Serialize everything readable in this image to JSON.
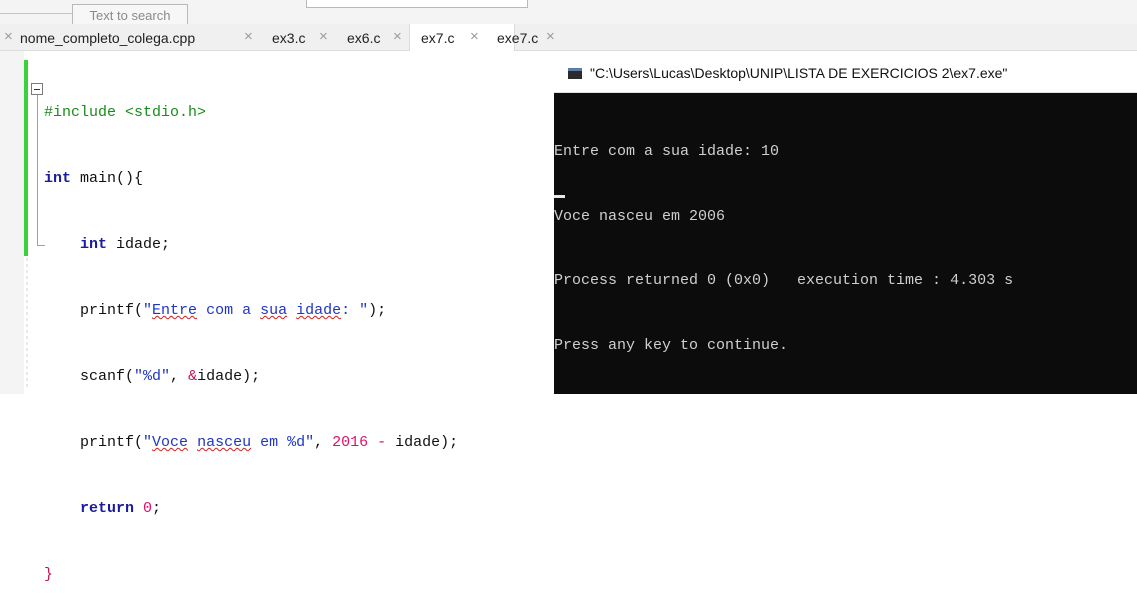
{
  "search": {
    "placeholder": "Text to search"
  },
  "tabs": [
    {
      "label": "nome_completo_colega.cpp",
      "active": false
    },
    {
      "label": "ex3.c",
      "active": false
    },
    {
      "label": "ex6.c",
      "active": false
    },
    {
      "label": "ex7.c",
      "active": true
    },
    {
      "label": "exe7.c",
      "active": false
    }
  ],
  "tab_close_glyph": "×",
  "code": {
    "l1": "#include <stdio.h>",
    "l2_kw": "int",
    "l2_rest": " main(){",
    "l3_kw": "int",
    "l3_rest": " idade;",
    "l4_fn": "printf(",
    "l4_str_a": "\"",
    "l4_w1": "Entre",
    "l4_str_b": " com a ",
    "l4_w2": "sua",
    "l4_str_c": " ",
    "l4_w3": "idade",
    "l4_str_d": ": \"",
    "l4_end": ");",
    "l5_fn": "scanf(",
    "l5_str": "\"%d\"",
    "l5_mid": ", ",
    "l5_amp": "&",
    "l5_end": "idade);",
    "l6_fn": "printf(",
    "l6_str_a": "\"",
    "l6_w1": "Voce",
    "l6_str_b": " ",
    "l6_w2": "nasceu",
    "l6_str_c": " em %d\"",
    "l6_mid": ", ",
    "l6_num": "2016",
    "l6_op": " - ",
    "l6_end": "idade);",
    "l7_kw": "return",
    "l7_num": " 0",
    "l7_end": ";",
    "l8": "}"
  },
  "console": {
    "title": "\"C:\\Users\\Lucas\\Desktop\\UNIP\\LISTA DE EXERCICIOS 2\\ex7.exe\"",
    "lines": [
      "Entre com a sua idade: 10",
      "Voce nasceu em 2006",
      "Process returned 0 (0x0)   execution time : 4.303 s",
      "Press any key to continue."
    ]
  },
  "colors": {
    "change_bar": "#3ad13a",
    "console_bg": "#0c0c0c",
    "string": "#1f35c8",
    "number": "#e0106a",
    "preprocessor": "#1a8b1a",
    "keyword": "#1b1b9f"
  }
}
